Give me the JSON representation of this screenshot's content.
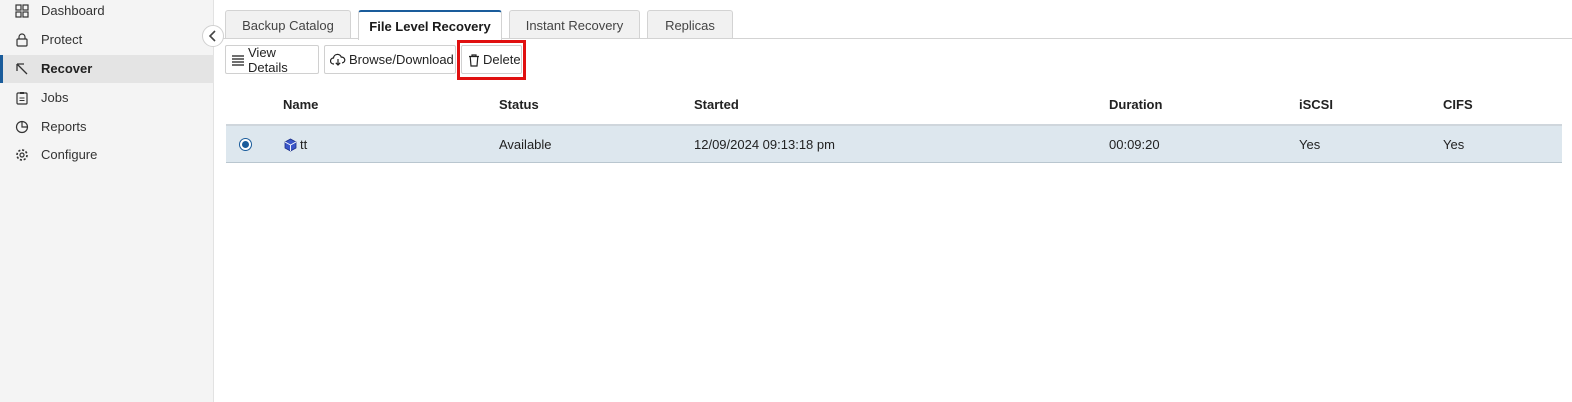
{
  "sidebar": {
    "items": [
      {
        "label": "Dashboard",
        "icon": "grid-icon"
      },
      {
        "label": "Protect",
        "icon": "lock-icon"
      },
      {
        "label": "Recover",
        "icon": "cursor-arrow-icon"
      },
      {
        "label": "Jobs",
        "icon": "clipboard-icon"
      },
      {
        "label": "Reports",
        "icon": "pie-chart-icon"
      },
      {
        "label": "Configure",
        "icon": "gear-icon"
      }
    ],
    "active": "Recover"
  },
  "tabs": [
    {
      "label": "Backup Catalog"
    },
    {
      "label": "File Level Recovery"
    },
    {
      "label": "Instant Recovery"
    },
    {
      "label": "Replicas"
    }
  ],
  "active_tab": "File Level Recovery",
  "toolbar": {
    "view_details": "View Details",
    "browse_download": "Browse/Download",
    "delete": "Delete"
  },
  "table": {
    "columns": [
      "Name",
      "Status",
      "Started",
      "Duration",
      "iSCSI",
      "CIFS"
    ],
    "rows": [
      {
        "name": "tt",
        "status": "Available",
        "started": "12/09/2024 09:13:18 pm",
        "duration": "00:09:20",
        "iscsi": "Yes",
        "cifs": "Yes",
        "selected": true
      }
    ]
  },
  "colors": {
    "accent": "#1a5c9b",
    "highlight": "#e01010",
    "selected_row": "#dde7ee"
  }
}
